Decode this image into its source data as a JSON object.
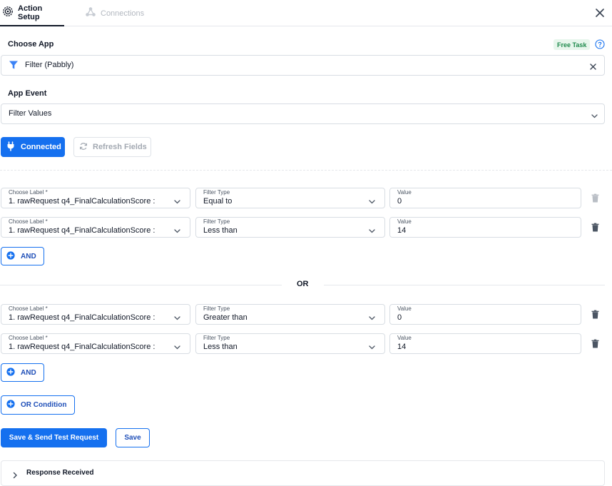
{
  "tabs": {
    "action_setup": "Action Setup",
    "connections": "Connections"
  },
  "choose_app": {
    "label": "Choose App",
    "badge": "Free Task",
    "value": "Filter (Pabbly)"
  },
  "app_event": {
    "label": "App Event",
    "value": "Filter Values"
  },
  "buttons": {
    "connected": "Connected",
    "refresh": "Refresh Fields",
    "and": "AND",
    "or_condition": "OR Condition",
    "save_send": "Save & Send Test Request",
    "save": "Save"
  },
  "field_labels": {
    "choose_label": "Choose Label *",
    "filter_type": "Filter Type",
    "value": "Value"
  },
  "or_separator": "OR",
  "groups": [
    {
      "rows": [
        {
          "label": "1. rawRequest q4_FinalCalculationScore :",
          "filter_type": "Equal to",
          "value": "0"
        },
        {
          "label": "1. rawRequest q4_FinalCalculationScore :",
          "filter_type": "Less than",
          "value": "14"
        }
      ]
    },
    {
      "rows": [
        {
          "label": "1. rawRequest q4_FinalCalculationScore :",
          "filter_type": "Greater than",
          "value": "0"
        },
        {
          "label": "1. rawRequest q4_FinalCalculationScore :",
          "filter_type": "Less than",
          "value": "14"
        }
      ]
    }
  ],
  "response": {
    "label": "Response Received"
  },
  "colors": {
    "primary": "#1570ef",
    "badge_bg": "#e7f6ec",
    "badge_text": "#1e8a4c"
  },
  "icons": {
    "tab_setup": "gear-icon",
    "tab_connections": "connections-icon",
    "close": "close-icon",
    "help": "help-circle-icon",
    "app": "filter-funnel-icon",
    "clear": "close-icon",
    "dropdown": "chevron-down-icon",
    "connected": "plug-icon",
    "refresh": "refresh-icon",
    "delete": "trash-icon",
    "add": "plus-circle-icon",
    "expand": "chevron-right-icon"
  }
}
